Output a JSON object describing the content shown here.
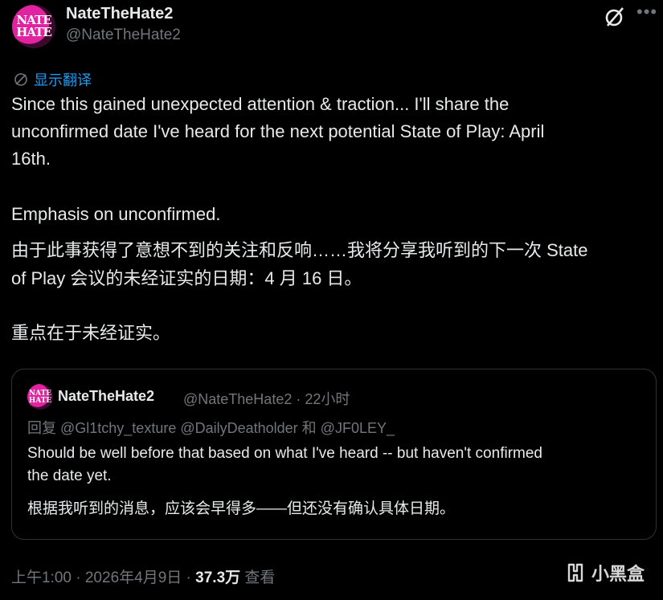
{
  "author": {
    "avatar_text": "NATE HATE",
    "display_name": "NateTheHate2",
    "handle": "@NateTheHate2"
  },
  "header_icons": [
    "grok-icon",
    "more-icon"
  ],
  "translate_label": "显示翻译",
  "tweet": {
    "line1": "Since this gained unexpected attention & traction... I'll share the",
    "line2": "unconfirmed date I've heard for the next potential State of Play: April",
    "line3": "16th.",
    "line4": "Emphasis on unconfirmed.",
    "line5": "由于此事获得了意想不到的关注和反响……我将分享我听到的下一次 State",
    "line6": "of Play 会议的未经证实的日期：4 月 16 日。",
    "line7": "重点在于未经证实。"
  },
  "quote": {
    "display_name": "NateTheHate2",
    "meta": "@NateTheHate2 · 22小时",
    "reply_line": "回复 @Gl1tchy_texture @DailyDeatholder 和 @JF0LEY_",
    "line1": "Should be well before that based on what I've heard -- but haven't confirmed",
    "line2": "the date yet.",
    "line3": "根据我听到的消息，应该会早得多——但还没有确认具体日期。"
  },
  "footer": {
    "time_date": "上午1:00 · 2026年4月9日 · ",
    "views": "37.3万",
    "views_label": " 查看"
  },
  "watermark": "小黑盒",
  "colors": {
    "background": "#000000",
    "text": "#e7e9ea",
    "muted": "#71767b",
    "link": "#1d9bf0",
    "avatar": "#e2239f"
  }
}
